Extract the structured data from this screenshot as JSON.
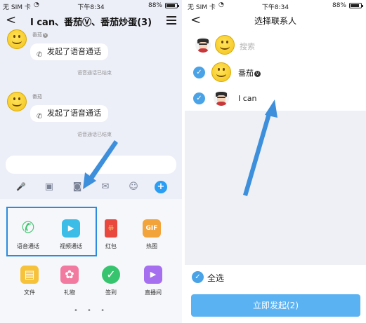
{
  "left": {
    "status": {
      "carrier": "无 SIM 卡",
      "time": "下午8:34",
      "battery_text": "88%",
      "battery_level": 0.88
    },
    "header": {
      "back": "<",
      "title": "I can、番茄Ⓥ、番茄炒蛋(3)"
    },
    "messages": [
      {
        "sender": "番茄",
        "badge": "V",
        "text": "发起了语音通话",
        "note": "语音通话已结束"
      },
      {
        "sender": "番茄",
        "badge": "",
        "text": "发起了语音通话",
        "note": "语音通话已结束"
      }
    ],
    "toolbar": {
      "mic": "🎤",
      "image": "▣",
      "camera": "◙",
      "redpacket": "✉",
      "emoji": "☺",
      "plus": "+"
    },
    "apps": [
      {
        "label": "语音通话",
        "icon": "✆",
        "color": "#3cc46b"
      },
      {
        "label": "视频通话",
        "icon": "▶",
        "color": "#3bbde8"
      },
      {
        "label": "红包",
        "icon": "恭",
        "color": "#e8483e"
      },
      {
        "label": "热图",
        "icon": "GIF",
        "color": "#f2a33a"
      },
      {
        "label": "文件",
        "icon": "▤",
        "color": "#f6c23a"
      },
      {
        "label": "礼物",
        "icon": "✿",
        "color": "#f27aa0"
      },
      {
        "label": "签到",
        "icon": "✓",
        "color": "#37c46f"
      },
      {
        "label": "直播间",
        "icon": "▶",
        "color": "#a56ff0"
      }
    ],
    "pager": "• • •",
    "colors": {
      "accent": "#2a9df4",
      "highlight": "#2a8be0",
      "arrow": "#3d8fdc"
    }
  },
  "right": {
    "status": {
      "carrier": "无 SIM 卡",
      "time": "下午8:34",
      "battery_text": "88%",
      "battery_level": 0.88
    },
    "header": {
      "back": "<",
      "title": "选择联系人"
    },
    "search_placeholder": "搜索",
    "contacts": [
      {
        "name": "番茄",
        "badge": "V",
        "checked": true
      },
      {
        "name": "I can",
        "badge": "",
        "checked": true
      }
    ],
    "select_all": "全选",
    "start_button": "立即发起(2)",
    "check_mark": "✓"
  }
}
